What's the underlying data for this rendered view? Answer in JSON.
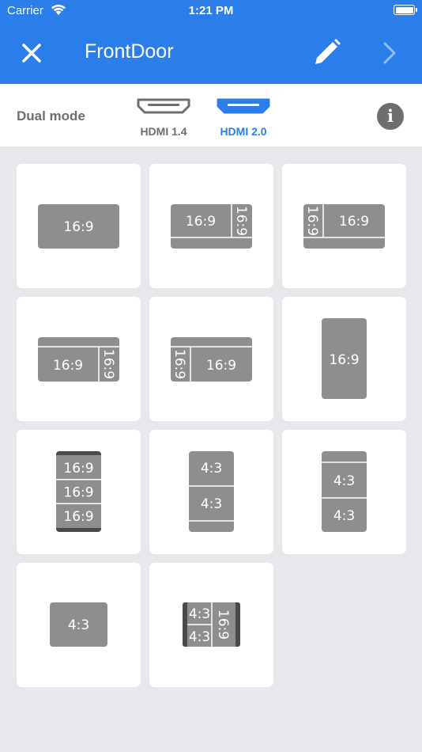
{
  "status": {
    "carrier": "Carrier",
    "time": "1:21 PM"
  },
  "nav": {
    "title": "FrontDoor"
  },
  "mode": {
    "label": "Dual mode",
    "options": [
      {
        "label": "HDMI 1.4",
        "selected": false
      },
      {
        "label": "HDMI 2.0",
        "selected": true
      }
    ]
  },
  "colors": {
    "accent": "#2b7de9",
    "screen": "#8e8e8e",
    "bar": "#4a4a4a",
    "bg": "#e8e8ec"
  },
  "icons": [
    "close-icon",
    "edit-pencil-icon",
    "chevron-right-icon",
    "info-icon",
    "hdmi-port-icon",
    "wifi-icon",
    "battery-icon"
  ],
  "layouts": {
    "l1": {
      "a": "16:9"
    },
    "l2": {
      "a": "16:9",
      "b": "16:9"
    },
    "l3": {
      "a": "16:9",
      "b": "16:9"
    },
    "l4": {
      "a": "16:9",
      "b": "16:9"
    },
    "l5": {
      "a": "16:9",
      "b": "16:9"
    },
    "l6": {
      "a": "16:9"
    },
    "l7": {
      "a": "16:9",
      "b": "16:9",
      "c": "16:9"
    },
    "l8": {
      "a": "4:3",
      "b": "4:3"
    },
    "l9": {
      "a": "4:3",
      "b": "4:3"
    },
    "l10": {
      "a": "4:3"
    },
    "l11": {
      "a": "4:3",
      "b": "4:3",
      "c": "16:9"
    }
  }
}
